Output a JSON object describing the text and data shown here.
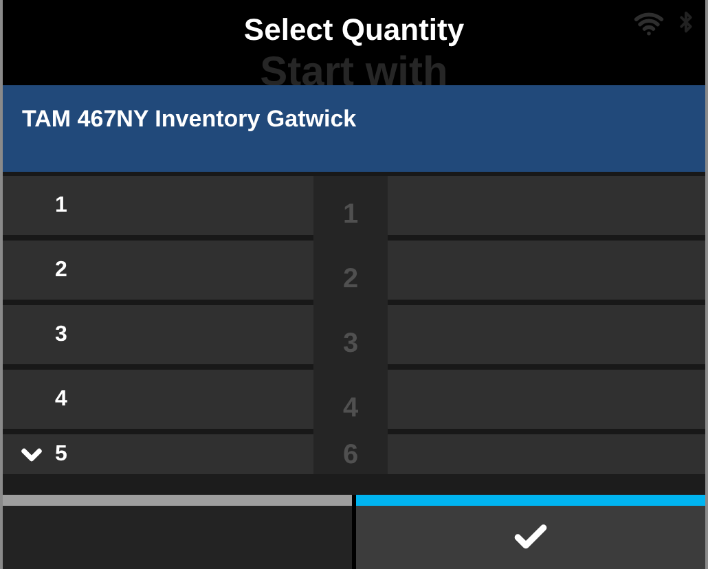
{
  "title": "Select Quantity",
  "background_heading": "Start with",
  "header": {
    "text": "TAM 467NY Inventory Gatwick"
  },
  "options": [
    {
      "label": "1",
      "background_number": "1",
      "scroll_hint": false
    },
    {
      "label": "2",
      "background_number": "2",
      "scroll_hint": false
    },
    {
      "label": "3",
      "background_number": "3",
      "scroll_hint": false
    },
    {
      "label": "4",
      "background_number": "4",
      "scroll_hint": false
    },
    {
      "label": "5",
      "background_number": "6",
      "scroll_hint": true
    }
  ],
  "buttons": [
    {
      "kind": "blank",
      "highlighted": false
    },
    {
      "kind": "confirm",
      "highlighted": true
    }
  ]
}
